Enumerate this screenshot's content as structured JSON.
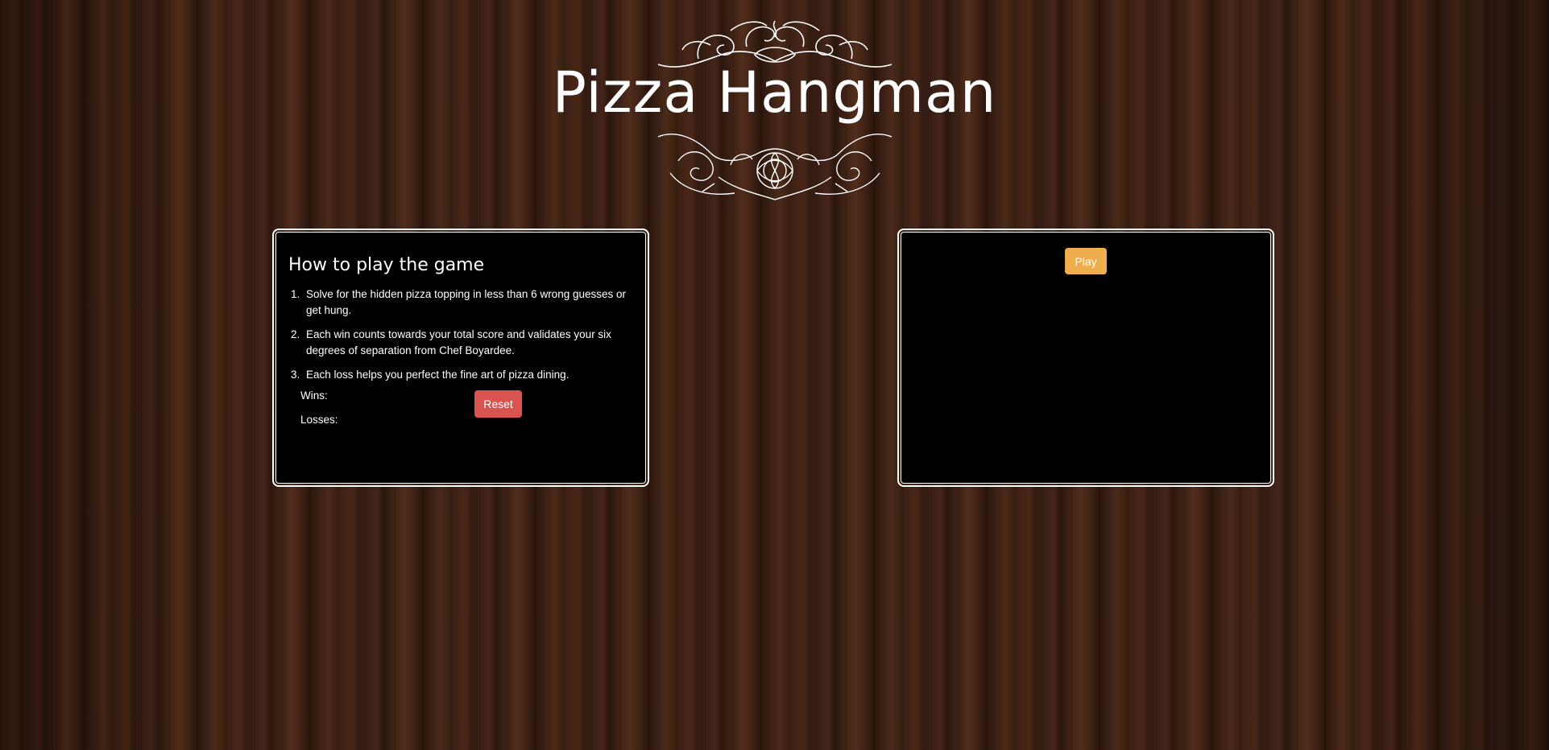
{
  "header": {
    "title": "Pizza Hangman"
  },
  "instructions": {
    "title": "How to play the game",
    "rules": [
      {
        "num": "1.",
        "text": "Solve for the hidden pizza topping in less than 6 wrong guesses or get hung."
      },
      {
        "num": "2.",
        "text": "Each win counts towards your total score and validates your six degrees of separation from Chef Boyardee."
      },
      {
        "num": "3.",
        "text": "Each loss helps you perfect the fine art of pizza dining."
      }
    ],
    "wins_label": "Wins:",
    "losses_label": "Losses:",
    "reset_label": "Reset"
  },
  "game": {
    "play_label": "Play"
  },
  "colors": {
    "reset_button": "#d9534f",
    "play_button": "#f0ad4e",
    "panel_background": "#000000",
    "wood_background": "#3a1f13"
  }
}
